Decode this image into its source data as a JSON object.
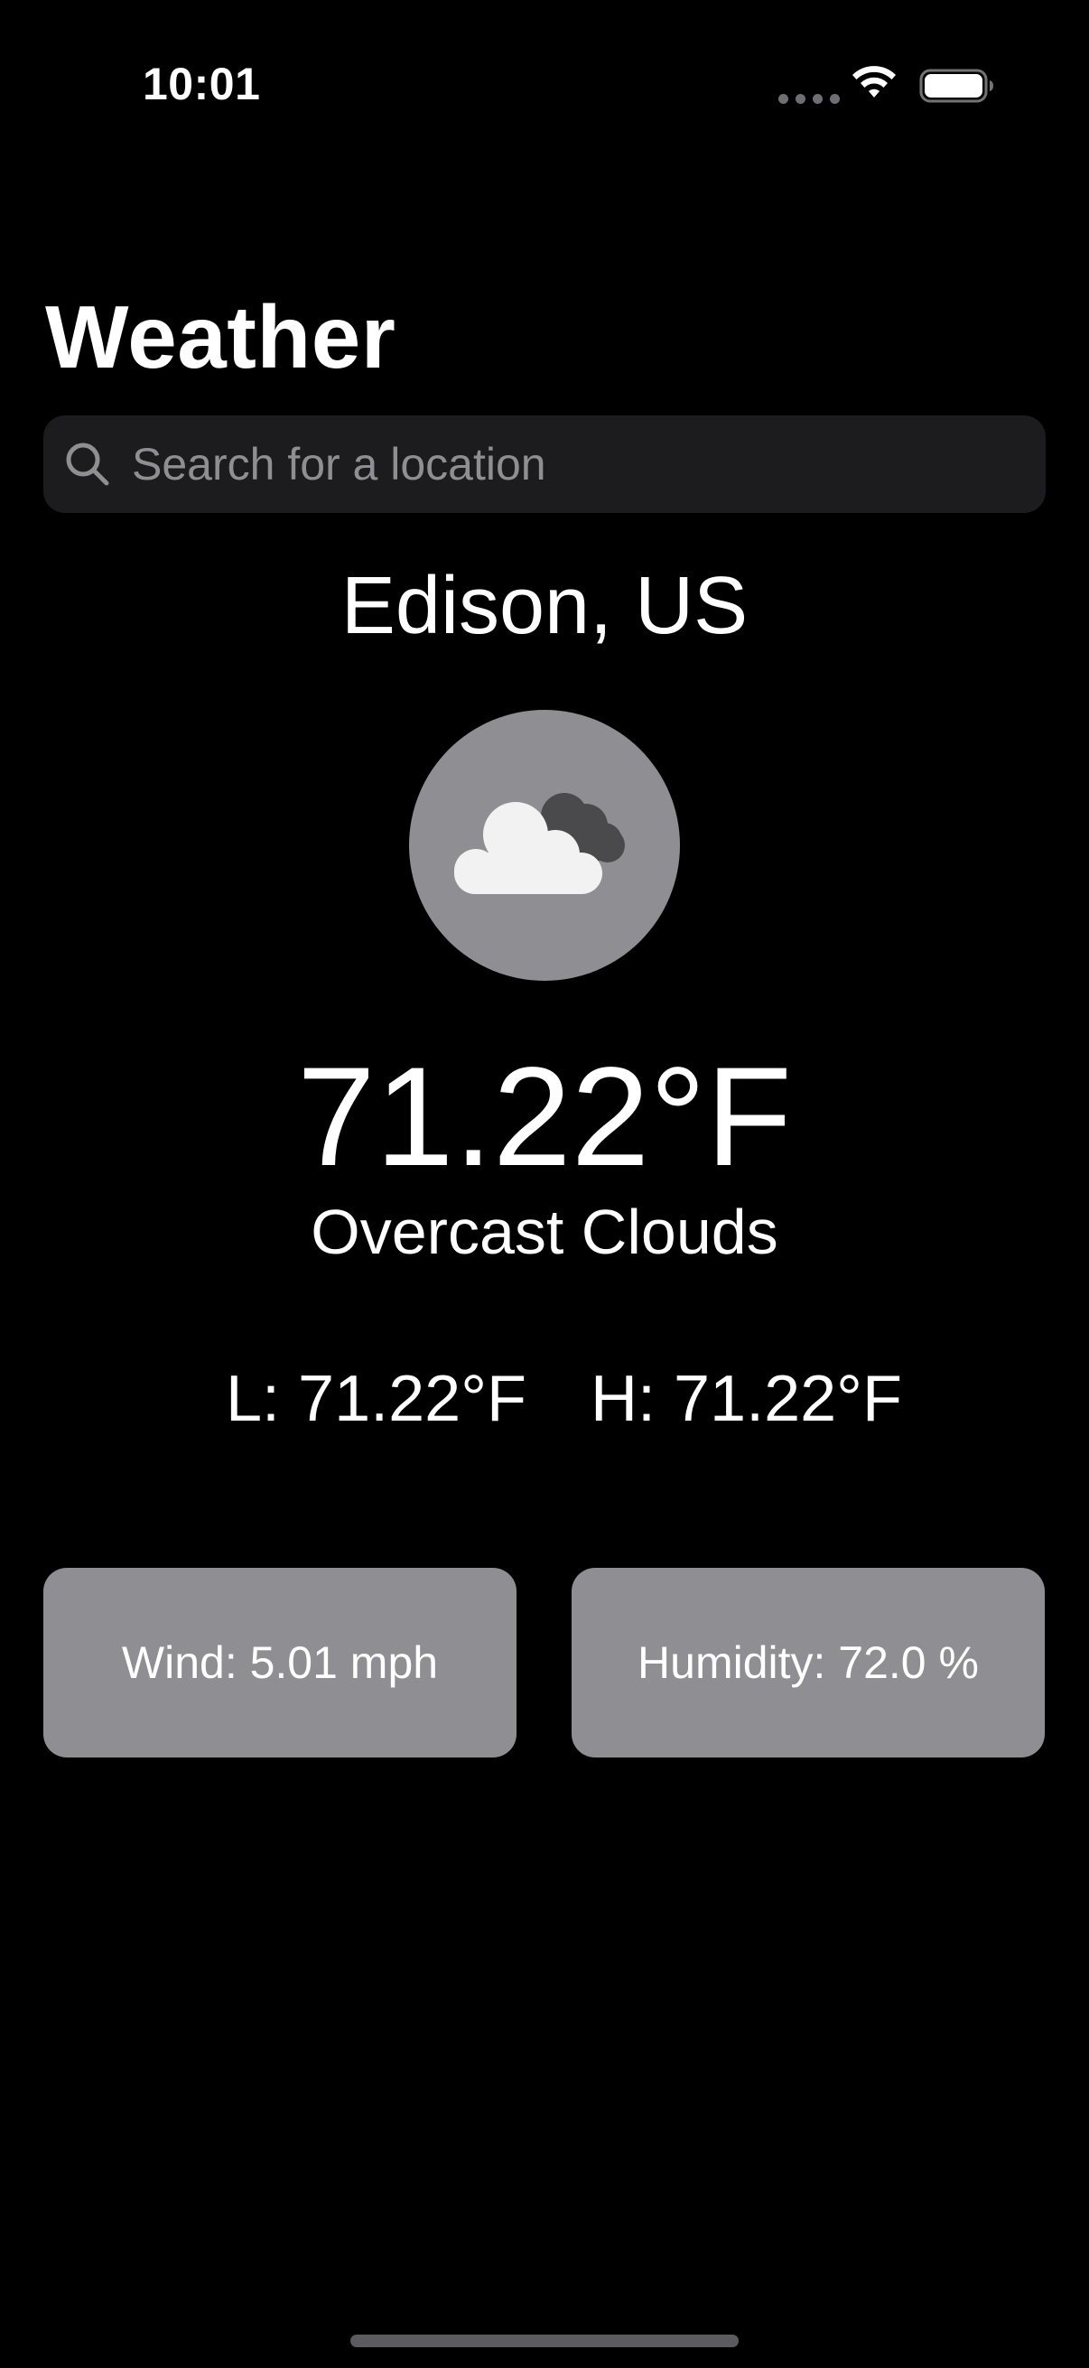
{
  "status_bar": {
    "time": "10:01",
    "signal_icon": "cellular-dots-icon",
    "wifi_icon": "wifi-icon",
    "battery_icon": "battery-icon"
  },
  "header": {
    "title": "Weather"
  },
  "search": {
    "placeholder": "Search for a location",
    "value": "",
    "icon": "search-icon"
  },
  "weather": {
    "location": "Edison, US",
    "icon": "overcast-clouds-icon",
    "temperature": "71.22°F",
    "condition": "Overcast Clouds",
    "low": "L: 71.22°F",
    "high": "H: 71.22°F"
  },
  "details": {
    "wind": "Wind: 5.01 mph",
    "humidity": "Humidity: 72.0 %"
  },
  "colors": {
    "background": "#000000",
    "search_bg": "#1c1c1e",
    "card_bg": "#8e8e93",
    "placeholder": "#8e8e93",
    "text": "#ffffff"
  }
}
